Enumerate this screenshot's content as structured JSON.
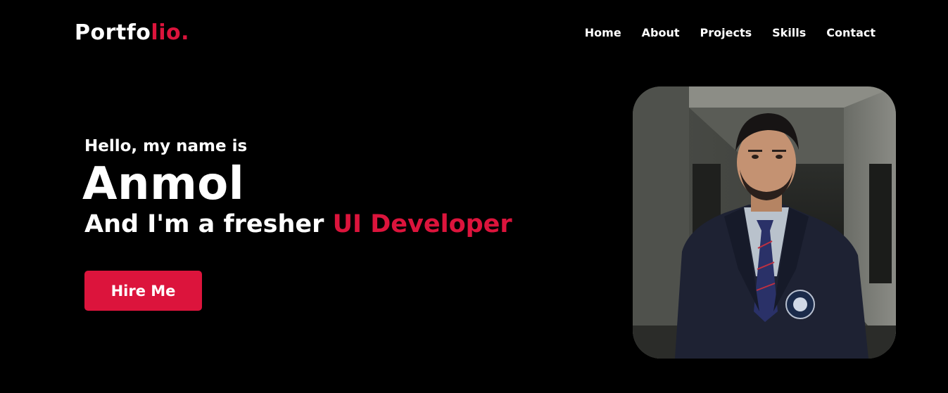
{
  "nav": {
    "logo_main": "Portfo",
    "logo_accent": "lio.",
    "links": [
      {
        "label": "Home"
      },
      {
        "label": "About"
      },
      {
        "label": "Projects"
      },
      {
        "label": "Skills"
      },
      {
        "label": "Contact"
      }
    ]
  },
  "hero": {
    "greeting": "Hello, my name is",
    "name": "Anmol",
    "role_prefix": "And I'm a fresher ",
    "role_accent": "UI Developer",
    "cta_label": "Hire Me"
  },
  "colors": {
    "background": "#000000",
    "accent": "#dc143c",
    "text": "#ffffff"
  }
}
